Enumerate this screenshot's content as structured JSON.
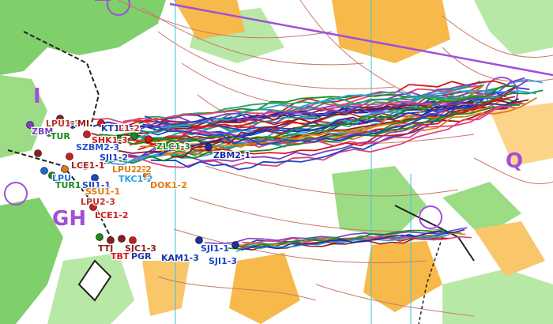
{
  "map": {
    "big_labels": [
      "GH",
      "I",
      "Q"
    ],
    "route_labels": [
      {
        "text": "LPU1-3",
        "color": "#c0392b"
      },
      {
        "text": "MI",
        "color": "#8e1c1c"
      },
      {
        "text": "ZBM",
        "color": "#7b3fc6"
      },
      {
        "text": "TUR",
        "color": "#1a8a1a"
      },
      {
        "text": "SHK1-3",
        "color": "#d01c1c"
      },
      {
        "text": "SZBM2-3",
        "color": "#2255cc"
      },
      {
        "text": "SJI1-2",
        "color": "#1e44c8"
      },
      {
        "text": "KT1-3",
        "color": "#1b3aa8"
      },
      {
        "text": "L1-2",
        "color": "#c0392b"
      },
      {
        "text": "LCE1-1",
        "color": "#b02020"
      },
      {
        "text": "LPU2-2",
        "color": "#e07a10"
      },
      {
        "text": "2-2",
        "color": "#e07a10"
      },
      {
        "text": "LPU",
        "color": "#1e6ad8"
      },
      {
        "text": "TUR1-1",
        "color": "#1a8a1a"
      },
      {
        "text": "SJI1-1",
        "color": "#1e44c8"
      },
      {
        "text": "TKC1-2",
        "color": "#2aa0e0"
      },
      {
        "text": "SSU1-1",
        "color": "#e07a10"
      },
      {
        "text": "DOK1-2",
        "color": "#e07a10"
      },
      {
        "text": "LPU2-3",
        "color": "#c0392b"
      },
      {
        "text": "LCE1-2",
        "color": "#d01c1c"
      },
      {
        "text": "ZLC1-3",
        "color": "#1a8a1a"
      },
      {
        "text": "ZBM2-1",
        "color": "#1b2f9e"
      },
      {
        "text": "TTJ",
        "color": "#8e1c1c"
      },
      {
        "text": "SJC1-3",
        "color": "#8e1c1c"
      },
      {
        "text": "TBT",
        "color": "#d01c1c"
      },
      {
        "text": "PGR",
        "color": "#1b3aa8"
      },
      {
        "text": "KAM1-3",
        "color": "#1b3aa8"
      },
      {
        "text": "SJI1-1",
        "color": "#1e44c8"
      },
      {
        "text": "SJI1-3",
        "color": "#1e44c8"
      }
    ]
  }
}
